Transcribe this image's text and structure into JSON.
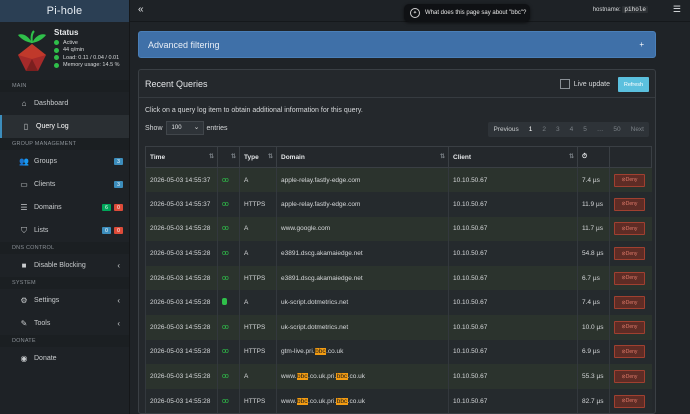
{
  "app": {
    "title": "Pi-hole"
  },
  "status": {
    "title": "Status",
    "lines": [
      "Active",
      "44 q/min",
      "Load: 0.11 / 0.04 / 0.01",
      "Memory usage: 14.5 %"
    ]
  },
  "topbar": {
    "hostname_label": "hostname:",
    "hostname_value": "pihole",
    "popup_text": "What does this page say about \"bbc\"?"
  },
  "nav": {
    "main_header": "MAIN",
    "dashboard": "Dashboard",
    "query_log": "Query Log",
    "group_header": "GROUP MANAGEMENT",
    "groups": "Groups",
    "groups_badge": "3",
    "clients": "Clients",
    "clients_badge": "3",
    "domains": "Domains",
    "domains_badge_green": "6",
    "domains_badge_red": "0",
    "lists": "Lists",
    "lists_badge_blue": "0",
    "lists_badge_red": "0",
    "dns_header": "DNS CONTROL",
    "disable_blocking": "Disable Blocking",
    "system_header": "SYSTEM",
    "settings": "Settings",
    "tools": "Tools",
    "donate_header": "DONATE",
    "donate": "Donate"
  },
  "advanced": {
    "label": "Advanced filtering",
    "plus": "+"
  },
  "queries": {
    "title": "Recent Queries",
    "live_update": "Live update",
    "refresh": "Refresh",
    "hint": "Click on a query log item to obtain additional information for this query.",
    "show": "Show",
    "entries_value": "100",
    "entries": "entries",
    "pager": {
      "previous": "Previous",
      "pages": [
        "1",
        "2",
        "3",
        "4",
        "5",
        "…",
        "50"
      ],
      "next": "Next"
    },
    "columns": [
      "Time",
      "",
      "Type",
      "Domain",
      "Client",
      "",
      ""
    ],
    "deny_label": "Deny",
    "rows": [
      {
        "time": "2026-05-03 14:55:37",
        "status": "ok",
        "type": "A",
        "domain": "apple-relay.fastly-edge.com",
        "client": "10.10.50.67",
        "reply": "7.4 µs"
      },
      {
        "time": "2026-05-03 14:55:37",
        "status": "ok",
        "type": "HTTPS",
        "domain": "apple-relay.fastly-edge.com",
        "client": "10.10.50.67",
        "reply": "11.9 µs"
      },
      {
        "time": "2026-05-03 14:55:28",
        "status": "ok",
        "type": "A",
        "domain": "www.google.com",
        "client": "10.10.50.67",
        "reply": "11.7 µs"
      },
      {
        "time": "2026-05-03 14:55:28",
        "status": "ok",
        "type": "A",
        "domain": "e3891.dscg.akamaiedge.net",
        "client": "10.10.50.67",
        "reply": "54.8 µs"
      },
      {
        "time": "2026-05-03 14:55:28",
        "status": "ok",
        "type": "HTTPS",
        "domain": "e3891.dscg.akamaiedge.net",
        "client": "10.10.50.67",
        "reply": "6.7 µs"
      },
      {
        "time": "2026-05-03 14:55:28",
        "status": "cache",
        "type": "A",
        "domain": "uk-script.dotmetrics.net",
        "client": "10.10.50.67",
        "reply": "7.4 µs"
      },
      {
        "time": "2026-05-03 14:55:28",
        "status": "ok",
        "type": "HTTPS",
        "domain": "uk-script.dotmetrics.net",
        "client": "10.10.50.67",
        "reply": "10.0 µs"
      },
      {
        "time": "2026-05-03 14:55:28",
        "status": "ok",
        "type": "HTTPS",
        "domain_parts": [
          "gtm-live.pri.",
          "bbc",
          ".co.uk"
        ],
        "client": "10.10.50.67",
        "reply": "6.9 µs"
      },
      {
        "time": "2026-05-03 14:55:28",
        "status": "ok",
        "type": "A",
        "domain_parts": [
          "www.",
          "bbc",
          ".co.uk.pri.",
          "bbc",
          ".co.uk"
        ],
        "client": "10.10.50.67",
        "reply": "55.3 µs"
      },
      {
        "time": "2026-05-03 14:55:28",
        "status": "ok",
        "type": "HTTPS",
        "domain_parts": [
          "www.",
          "bbc",
          ".co.uk.pri.",
          "bbc",
          ".co.uk"
        ],
        "client": "10.10.50.67",
        "reply": "82.7 µs"
      }
    ]
  },
  "colors": {
    "accent": "#3c8dbc",
    "advanced_bg": "#3f70a8",
    "ok": "#2fbf4a",
    "highlight": "#f39c12",
    "deny": "#dd4b39"
  }
}
